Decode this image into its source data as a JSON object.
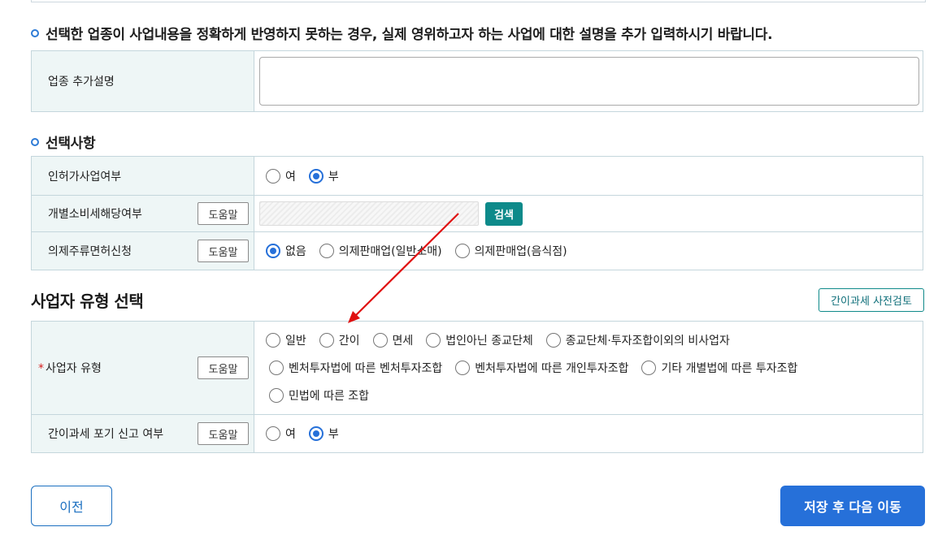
{
  "section_desc": {
    "title": "선택한 업종이 사업내용을 정확하게 반영하지 못하는 경우, 실제 영위하고자 하는 사업에 대한 설명을 추가 입력하시기 바랍니다.",
    "row_label": "업종 추가설명",
    "textarea_value": ""
  },
  "section_options": {
    "title": "선택사항",
    "rows": {
      "license": {
        "label": "인허가사업여부",
        "opt_yes": "여",
        "opt_no": "부"
      },
      "consumption_tax": {
        "label": "개별소비세해당여부",
        "help": "도움말",
        "search": "검색"
      },
      "liquor": {
        "label": "의제주류면허신청",
        "help": "도움말",
        "opt1": "없음",
        "opt2": "의제판매업(일반소매)",
        "opt3": "의제판매업(음식점)"
      }
    }
  },
  "biz_type": {
    "title": "사업자 유형 선택",
    "precheck_button": "간이과세 사전검토",
    "type_row": {
      "required_mark": "*",
      "label": "사업자 유형",
      "help": "도움말",
      "options": [
        "일반",
        "간이",
        "면세",
        "법인아닌 종교단체",
        "종교단체·투자조합이외의 비사업자",
        "벤처투자법에 따른 벤처투자조합",
        "벤처투자법에 따른 개인투자조합",
        "기타 개별법에 따른 투자조합",
        "민법에 따른 조합"
      ]
    },
    "waiver_row": {
      "label": "간이과세 포기 신고 여부",
      "help": "도움말",
      "opt_yes": "여",
      "opt_no": "부"
    }
  },
  "footer": {
    "prev": "이전",
    "next": "저장 후 다음 이동"
  },
  "colors": {
    "accent": "#2670d9",
    "teal": "#0d8a8a",
    "header_bg": "#eef6f6",
    "arrow": "#e01010"
  }
}
